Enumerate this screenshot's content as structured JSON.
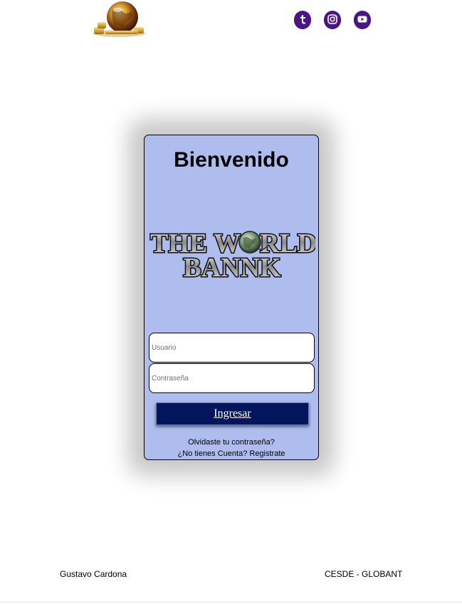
{
  "header": {
    "logo_icon": "globe-coins-icon",
    "social": [
      {
        "name": "tumblr",
        "icon": "tumblr-icon"
      },
      {
        "name": "instagram",
        "icon": "instagram-icon"
      },
      {
        "name": "youtube",
        "icon": "youtube-icon"
      }
    ],
    "social_color": "#4a1584"
  },
  "login": {
    "title": "Bienvenido",
    "brand_line1_a": "THE W",
    "brand_line1_b": "RLD",
    "brand_line2": "BANNK",
    "username_placeholder": "Usuario",
    "password_placeholder": "Contraseña",
    "submit_label": "Ingresar",
    "forgot_link": "Olvidaste tu contraseña?",
    "register_link": "¿No tienes Cuenta? Registrate",
    "card_color": "#aebcee",
    "button_color": "#03155c"
  },
  "footer": {
    "author": "Gustavo Cardona",
    "org": "CESDE - GLOBANT"
  }
}
